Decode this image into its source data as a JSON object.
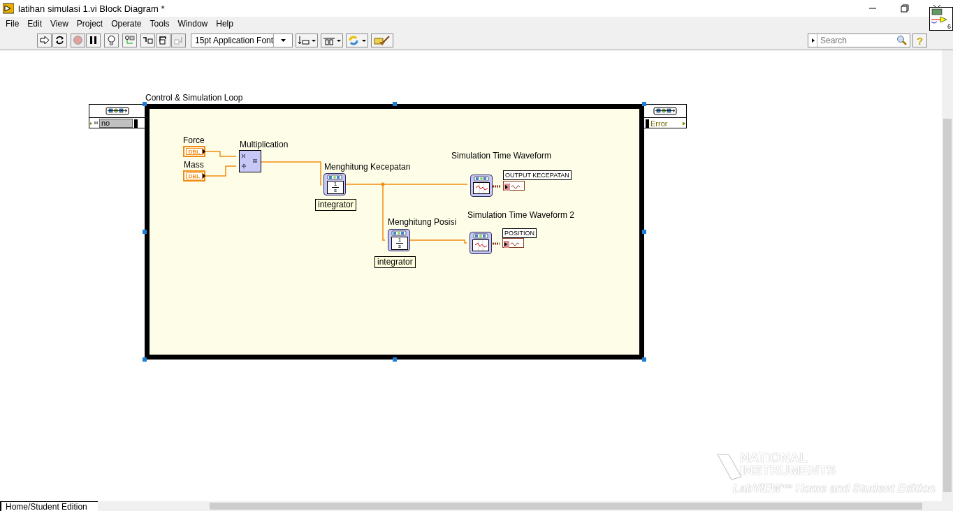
{
  "window": {
    "title": "latihan simulasi 1.vi Block Diagram *"
  },
  "menu": [
    "File",
    "Edit",
    "View",
    "Project",
    "Operate",
    "Tools",
    "Window",
    "Help"
  ],
  "toolbar": {
    "buttons": [
      {
        "kind": "run",
        "disabled": false
      },
      {
        "kind": "run-continuous",
        "disabled": false
      },
      {
        "kind": "abort",
        "disabled": true
      },
      {
        "kind": "pause",
        "disabled": false
      },
      {
        "kind": "highlight",
        "disabled": false
      },
      {
        "kind": "retain",
        "disabled": false
      },
      {
        "kind": "step-into",
        "disabled": false
      },
      {
        "kind": "step-over",
        "disabled": false
      },
      {
        "kind": "step-out",
        "disabled": true
      }
    ],
    "font": "15pt Application Font",
    "tools": [
      {
        "kind": "align"
      },
      {
        "kind": "distribute"
      },
      {
        "kind": "reorder"
      },
      {
        "kind": "cleanup"
      }
    ],
    "search": {
      "placeholder": "Search"
    },
    "help": "?",
    "vi_icon_badge": "6"
  },
  "diagram": {
    "loop": {
      "label": "Control & Simulation Loop",
      "input": "no",
      "output": "Error"
    },
    "nodes": [
      {
        "kind": "control",
        "label": "Force",
        "type": "DBL"
      },
      {
        "kind": "control",
        "label": "Mass",
        "type": "DBL"
      },
      {
        "kind": "multiply",
        "label": "Multiplication"
      },
      {
        "kind": "integrator",
        "label": "Menghitung Kecepatan",
        "numerator": "1",
        "denominator": "s",
        "caption": "integrator"
      },
      {
        "kind": "integrator",
        "label": "Menghitung Posisi",
        "numerator": "1",
        "denominator": "s",
        "caption": "integrator"
      },
      {
        "kind": "waveform",
        "label": "Simulation Time Waveform",
        "output": "OUTPUT KECEPATAN"
      },
      {
        "kind": "waveform",
        "label": "Simulation Time Waveform 2",
        "output": "POSITION"
      }
    ]
  },
  "branding": {
    "lines": [
      "NATIONAL",
      "INSTRUMENTS"
    ],
    "edition": "LabVIEW™ Home and Student Edition"
  },
  "status_bar": "Home/Student Edition"
}
